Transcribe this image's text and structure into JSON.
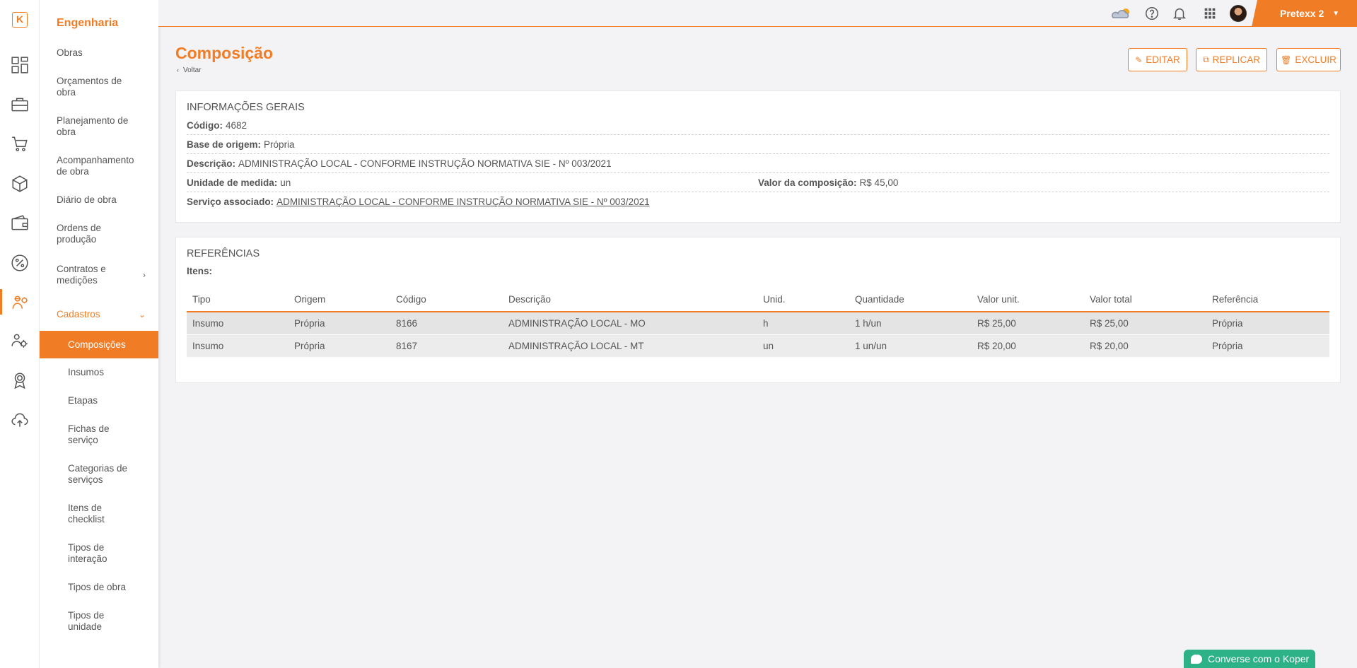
{
  "brand": {
    "logo_letter": "K",
    "accent": "#f07d26"
  },
  "rail": [
    {
      "name": "dashboard-icon"
    },
    {
      "name": "briefcase-icon"
    },
    {
      "name": "cart-icon"
    },
    {
      "name": "boxes-icon"
    },
    {
      "name": "wallet-icon"
    },
    {
      "name": "percent-icon"
    },
    {
      "name": "engineering-icon",
      "active": true
    },
    {
      "name": "people-settings-icon"
    },
    {
      "name": "badge-icon"
    },
    {
      "name": "cloud-upload-icon"
    }
  ],
  "sidebar": {
    "title": "Engenharia",
    "items": [
      {
        "label": "Obras"
      },
      {
        "label": "Orçamentos de obra"
      },
      {
        "label": "Planejamento de obra"
      },
      {
        "label": "Acompanhamento de obra"
      },
      {
        "label": "Diário de obra"
      },
      {
        "label": "Ordens de produção"
      },
      {
        "label": "Contratos e medições",
        "arrow": "›"
      },
      {
        "label": "Cadastros",
        "arrow": "⌄"
      }
    ],
    "subitems": [
      {
        "label": "Composições",
        "active": true
      },
      {
        "label": "Insumos"
      },
      {
        "label": "Etapas"
      },
      {
        "label": "Fichas de serviço"
      },
      {
        "label": "Categorias de serviços"
      },
      {
        "label": "Itens de checklist"
      },
      {
        "label": "Tipos de interação"
      },
      {
        "label": "Tipos de obra"
      },
      {
        "label": "Tipos de unidade"
      }
    ]
  },
  "topbar": {
    "icons": [
      "weather-icon",
      "help-icon",
      "bell-icon",
      "apps-grid-icon"
    ],
    "user": "Pretexx 2",
    "caret": "▼"
  },
  "page": {
    "title": "Composição",
    "back": "Voltar",
    "actions": {
      "edit": "EDITAR",
      "replicate": "REPLICAR",
      "delete": "EXCLUIR"
    }
  },
  "info": {
    "title": "INFORMAÇÕES GERAIS",
    "codigo_label": "Código:",
    "codigo": "4682",
    "base_label": "Base de origem:",
    "base": "Própria",
    "descricao_label": "Descrição:",
    "descricao": "ADMINISTRAÇÃO LOCAL - CONFORME INSTRUÇÃO NORMATIVA SIE - Nº 003/2021",
    "unidade_label": "Unidade de medida:",
    "unidade": "un",
    "valor_label": "Valor da composição:",
    "valor": "R$ 45,00",
    "servico_label": "Serviço associado:",
    "servico": "ADMINISTRAÇÃO LOCAL - CONFORME INSTRUÇÃO NORMATIVA SIE - Nº 003/2021"
  },
  "refs": {
    "title": "REFERÊNCIAS",
    "items_label": "Itens:",
    "columns": [
      "Tipo",
      "Origem",
      "Código",
      "Descrição",
      "Unid.",
      "Quantidade",
      "Valor unit.",
      "Valor total",
      "Referência"
    ],
    "rows": [
      [
        "Insumo",
        "Própria",
        "8166",
        "ADMINISTRAÇÃO LOCAL - MO",
        "h",
        "1 h/un",
        "R$ 25,00",
        "R$ 25,00",
        "Própria"
      ],
      [
        "Insumo",
        "Própria",
        "8167",
        "ADMINISTRAÇÃO LOCAL - MT",
        "un",
        "1 un/un",
        "R$ 20,00",
        "R$ 20,00",
        "Própria"
      ]
    ]
  },
  "chat": {
    "label": "Converse com o Koper"
  }
}
